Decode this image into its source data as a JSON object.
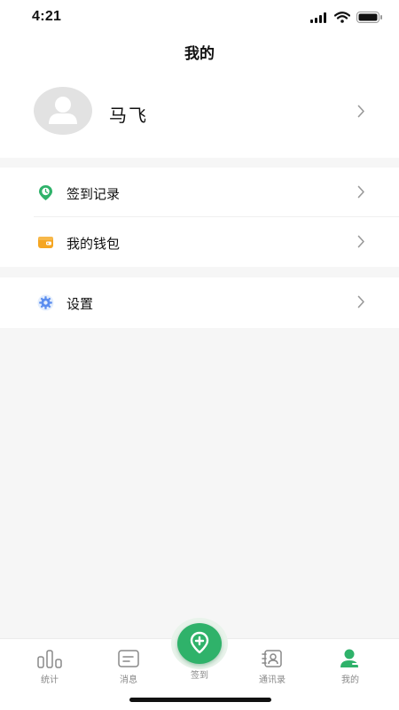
{
  "status_bar": {
    "time": "4:21",
    "icons": [
      "signal-icon",
      "wifi-icon",
      "battery-icon"
    ]
  },
  "header": {
    "title": "我的"
  },
  "profile": {
    "name": "马飞"
  },
  "menu": {
    "group1": [
      {
        "label": "签到记录",
        "icon": "clock-pin-icon"
      },
      {
        "label": "我的钱包",
        "icon": "wallet-icon"
      }
    ],
    "group2": [
      {
        "label": "设置",
        "icon": "gear-icon"
      }
    ]
  },
  "tabbar": {
    "tabs": [
      {
        "label": "统计",
        "icon": "bar-chart-icon"
      },
      {
        "label": "消息",
        "icon": "message-icon"
      },
      {
        "label": "签到",
        "icon": "location-add-icon"
      },
      {
        "label": "通讯录",
        "icon": "contacts-icon"
      },
      {
        "label": "我的",
        "icon": "user-icon",
        "active": true
      }
    ]
  },
  "colors": {
    "accent": "#2fb26a",
    "wallet": "#f5a623",
    "settings": "#5b8def",
    "background": "#f6f6f6"
  }
}
